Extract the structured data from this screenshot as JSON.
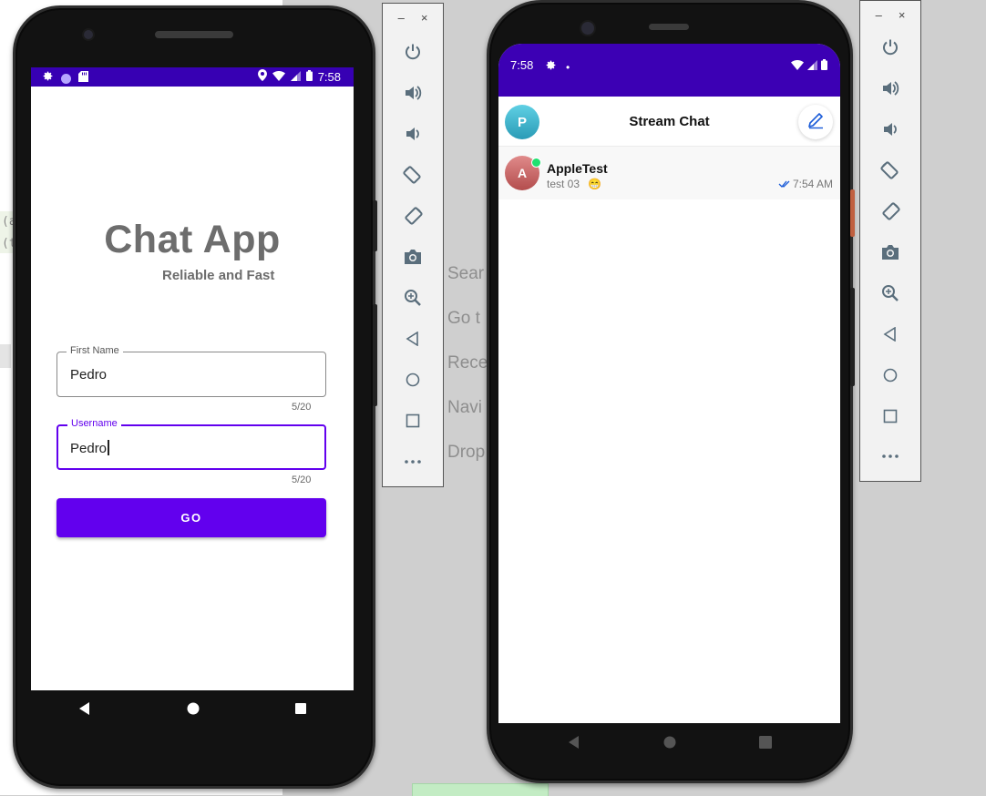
{
  "background": {
    "snippets": [
      "(a",
      "(t"
    ],
    "menu_items": [
      "Sear",
      "Go t",
      "Rece",
      "Navi",
      "Drop"
    ]
  },
  "emulator_left": {
    "status_time": "7:58",
    "app_title": "Chat App",
    "app_subtitle": "Reliable and Fast",
    "first_name": {
      "label": "First Name",
      "value": "Pedro",
      "counter": "5/20"
    },
    "username": {
      "label": "Username",
      "value": "Pedro",
      "counter": "5/20"
    },
    "go_label": "GO",
    "toolbar_window": {
      "minimize": "–",
      "close": "×"
    },
    "toolbar_icons": [
      "power-icon",
      "volume-up-icon",
      "volume-down-icon",
      "rotate-left-icon",
      "rotate-right-icon",
      "camera-icon",
      "zoom-icon",
      "back-icon",
      "home-icon",
      "overview-icon",
      "more-icon"
    ]
  },
  "emulator_right": {
    "status_time": "7:58",
    "status_dot": "•",
    "header_title": "Stream Chat",
    "user_avatar_initial": "P",
    "channel": {
      "avatar_initial": "A",
      "name": "AppleTest",
      "last_message": "test 03",
      "emoji": "😁",
      "time": "7:54 AM"
    },
    "toolbar_window": {
      "minimize": "–",
      "close": "×"
    }
  },
  "colors": {
    "primary": "#6200ee",
    "status_bar": "#3700b3",
    "status_bar_right": "#3c00b4",
    "title_grey": "#6d6d6d",
    "online": "#20e070",
    "compose_blue": "#1a5bd8"
  }
}
